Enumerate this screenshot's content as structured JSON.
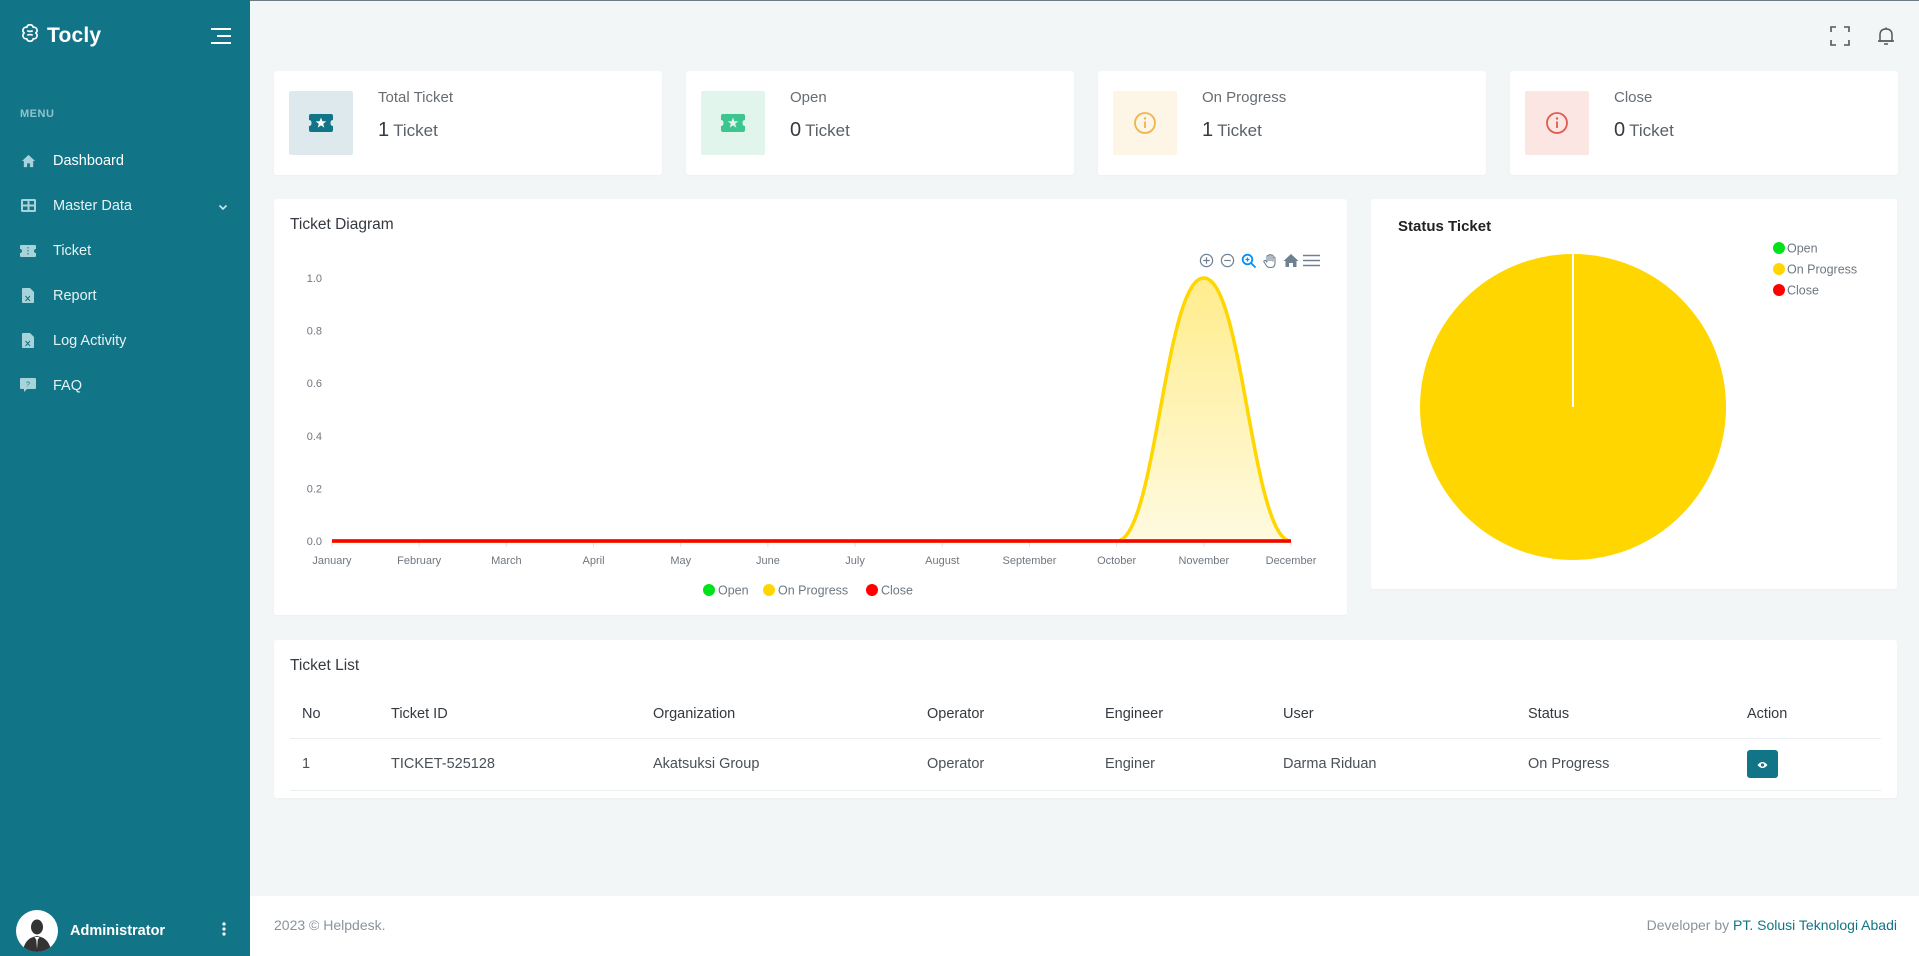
{
  "app": {
    "brand": "Tocly"
  },
  "sidebar": {
    "menu_label": "MENU",
    "items": [
      {
        "label": "Dashboard",
        "icon": "home-icon",
        "active": true
      },
      {
        "label": "Master Data",
        "icon": "grid-icon",
        "has_submenu": true
      },
      {
        "label": "Ticket",
        "icon": "ticket-icon"
      },
      {
        "label": "Report",
        "icon": "file-excel-icon"
      },
      {
        "label": "Log Activity",
        "icon": "file-excel-icon"
      },
      {
        "label": "FAQ",
        "icon": "question-icon"
      }
    ],
    "user": {
      "name": "Administrator"
    }
  },
  "stats": [
    {
      "title": "Total Ticket",
      "value": "1",
      "unit": "Ticket",
      "icon": "ticket-star-icon",
      "color": "#117587",
      "bg": "#dde9ec"
    },
    {
      "title": "Open",
      "value": "0",
      "unit": "Ticket",
      "icon": "ticket-star-icon",
      "color": "#3cc58f",
      "bg": "#e1f5ec"
    },
    {
      "title": "On Progress",
      "value": "1",
      "unit": "Ticket",
      "icon": "info-circle-icon",
      "color": "#f1b44c",
      "bg": "#fdf5e6"
    },
    {
      "title": "Close",
      "value": "0",
      "unit": "Ticket",
      "icon": "info-circle-icon",
      "color": "#e15b4d",
      "bg": "#fce6e4"
    }
  ],
  "ticket_diagram": {
    "title": "Ticket Diagram"
  },
  "status_ticket": {
    "title": "Status Ticket"
  },
  "chart_data": [
    {
      "type": "area",
      "title": "Ticket Diagram",
      "xlabel": "",
      "ylabel": "",
      "categories": [
        "January",
        "February",
        "March",
        "April",
        "May",
        "June",
        "July",
        "August",
        "September",
        "October",
        "November",
        "December"
      ],
      "yticks": [
        "0.0",
        "0.2",
        "0.4",
        "0.6",
        "0.8",
        "1.0"
      ],
      "ylim": [
        0,
        1
      ],
      "grid": false,
      "legend": "bottom",
      "series": [
        {
          "name": "Open",
          "color": "#00e31b",
          "values": [
            0,
            0,
            0,
            0,
            0,
            0,
            0,
            0,
            0,
            0,
            0,
            0
          ]
        },
        {
          "name": "On Progress",
          "color": "#ffd600",
          "values": [
            0,
            0,
            0,
            0,
            0,
            0,
            0,
            0,
            0,
            0,
            1,
            0
          ]
        },
        {
          "name": "Close",
          "color": "#ff0000",
          "values": [
            0,
            0,
            0,
            0,
            0,
            0,
            0,
            0,
            0,
            0,
            0,
            0
          ]
        }
      ]
    },
    {
      "type": "pie",
      "title": "Status Ticket",
      "legend": "top-right",
      "categories": [
        "Open",
        "On Progress",
        "Close"
      ],
      "colors": [
        "#00e31b",
        "#ffd600",
        "#ff0000"
      ],
      "values": [
        0,
        1,
        0
      ]
    }
  ],
  "ticket_list": {
    "title": "Ticket List",
    "columns": [
      "No",
      "Ticket ID",
      "Organization",
      "Operator",
      "Engineer",
      "User",
      "Status",
      "Action"
    ],
    "rows": [
      {
        "no": "1",
        "ticket_id": "TICKET-525128",
        "organization": "Akatsuksi Group",
        "operator": "Operator",
        "engineer": "Enginer",
        "user": "Darma Riduan",
        "status": "On Progress",
        "action_icon": "eye-icon"
      }
    ]
  },
  "footer": {
    "copyright": "2023 © Helpdesk.",
    "developer_prefix": "Developer by ",
    "developer_name": "PT. Solusi Teknologi Abadi"
  }
}
